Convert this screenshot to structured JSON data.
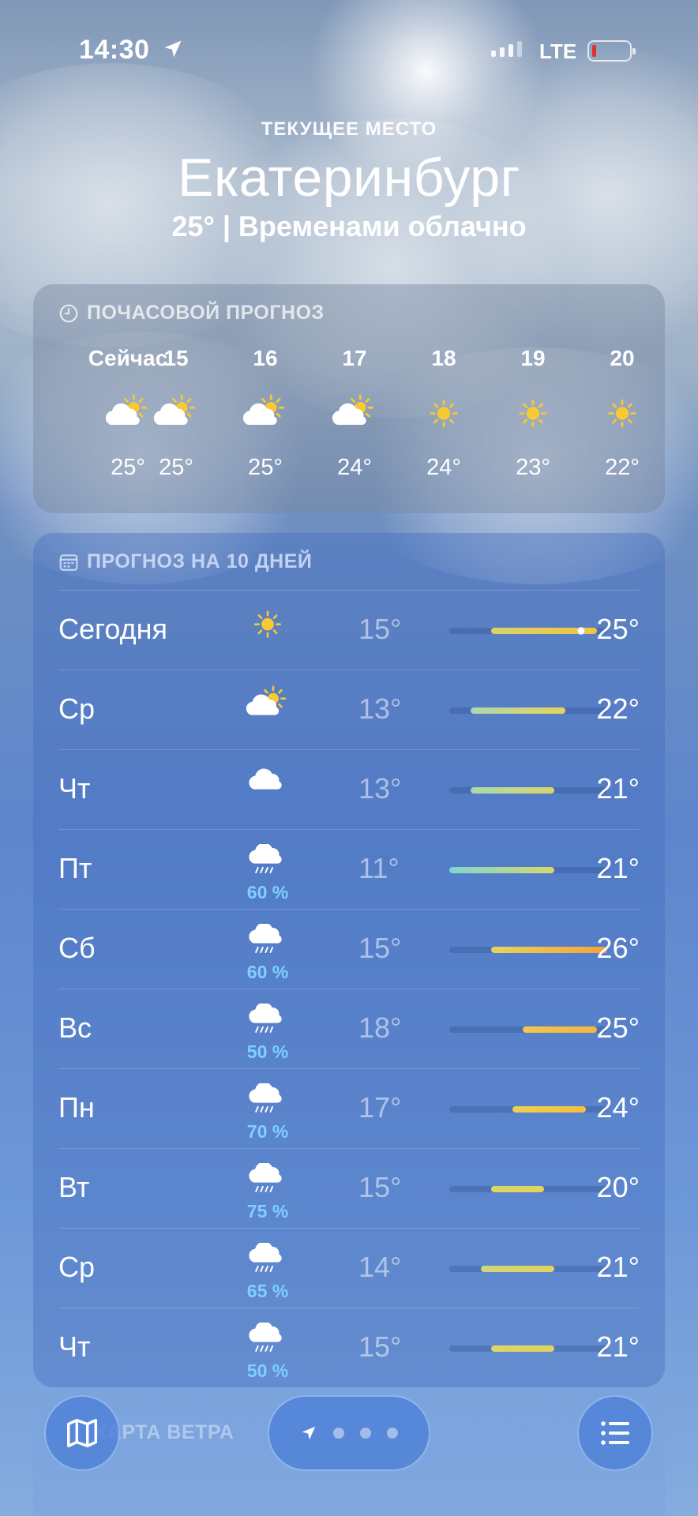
{
  "status_bar": {
    "time": "14:30",
    "network": "LTE"
  },
  "header": {
    "current_location_label": "ТЕКУЩЕЕ МЕСТО",
    "city": "Екатеринбург",
    "summary": "25°  |  Временами облачно"
  },
  "hourly": {
    "title": "ПОЧАСОВОЙ ПРОГНОЗ",
    "items": [
      {
        "label": "Сейчас",
        "icon": "partly-cloudy-icon",
        "temp": "25°"
      },
      {
        "label": "15",
        "icon": "partly-cloudy-icon",
        "temp": "25°"
      },
      {
        "label": "16",
        "icon": "partly-cloudy-icon",
        "temp": "25°"
      },
      {
        "label": "17",
        "icon": "partly-cloudy-icon",
        "temp": "24°"
      },
      {
        "label": "18",
        "icon": "sun-icon",
        "temp": "24°"
      },
      {
        "label": "19",
        "icon": "sun-icon",
        "temp": "23°"
      },
      {
        "label": "20",
        "icon": "sun-icon",
        "temp": "22°"
      }
    ]
  },
  "daily": {
    "title": "ПРОГНОЗ НА 10 ДНЕЙ",
    "range_min": 11,
    "range_max": 26,
    "items": [
      {
        "day": "Сегодня",
        "icon": "sun-icon",
        "pop": "",
        "lo": "15°",
        "hi": "25°",
        "lo_v": 15,
        "hi_v": 25,
        "current_v": 25,
        "colors": [
          "#d9d36a",
          "#f3c43c"
        ]
      },
      {
        "day": "Ср",
        "icon": "partly-cloudy-icon",
        "pop": "",
        "lo": "13°",
        "hi": "22°",
        "lo_v": 13,
        "hi_v": 22,
        "colors": [
          "#a9d8b0",
          "#e8d25a"
        ]
      },
      {
        "day": "Чт",
        "icon": "cloud-icon",
        "pop": "",
        "lo": "13°",
        "hi": "21°",
        "lo_v": 13,
        "hi_v": 21,
        "colors": [
          "#a9d8b0",
          "#d9d66a"
        ]
      },
      {
        "day": "Пт",
        "icon": "rain-icon",
        "pop": "60 %",
        "lo": "11°",
        "hi": "21°",
        "lo_v": 11,
        "hi_v": 21,
        "colors": [
          "#7fd6d0",
          "#d9d66a"
        ]
      },
      {
        "day": "Сб",
        "icon": "rain-icon",
        "pop": "60 %",
        "lo": "15°",
        "hi": "26°",
        "lo_v": 15,
        "hi_v": 26,
        "colors": [
          "#e6d45a",
          "#f5a23a"
        ]
      },
      {
        "day": "Вс",
        "icon": "rain-icon",
        "pop": "50 %",
        "lo": "18°",
        "hi": "25°",
        "lo_v": 18,
        "hi_v": 25,
        "colors": [
          "#f0c84a",
          "#f3b63c"
        ]
      },
      {
        "day": "Пн",
        "icon": "rain-icon",
        "pop": "70 %",
        "lo": "17°",
        "hi": "24°",
        "lo_v": 17,
        "hi_v": 24,
        "colors": [
          "#ecd052",
          "#f2c040"
        ]
      },
      {
        "day": "Вт",
        "icon": "rain-icon",
        "pop": "75 %",
        "lo": "15°",
        "hi": "20°",
        "lo_v": 15,
        "hi_v": 20,
        "colors": [
          "#d9d66a",
          "#e3d35c"
        ]
      },
      {
        "day": "Ср",
        "icon": "rain-icon",
        "pop": "65 %",
        "lo": "14°",
        "hi": "21°",
        "lo_v": 14,
        "hi_v": 21,
        "colors": [
          "#cfd77a",
          "#e3d35c"
        ]
      },
      {
        "day": "Чт",
        "icon": "rain-icon",
        "pop": "50 %",
        "lo": "15°",
        "hi": "21°",
        "lo_v": 15,
        "hi_v": 21,
        "colors": [
          "#d9d66a",
          "#e3d35c"
        ]
      }
    ]
  },
  "wind_card": {
    "title": "КАРТА ВЕТРА"
  },
  "pager": {
    "pages": 3
  }
}
